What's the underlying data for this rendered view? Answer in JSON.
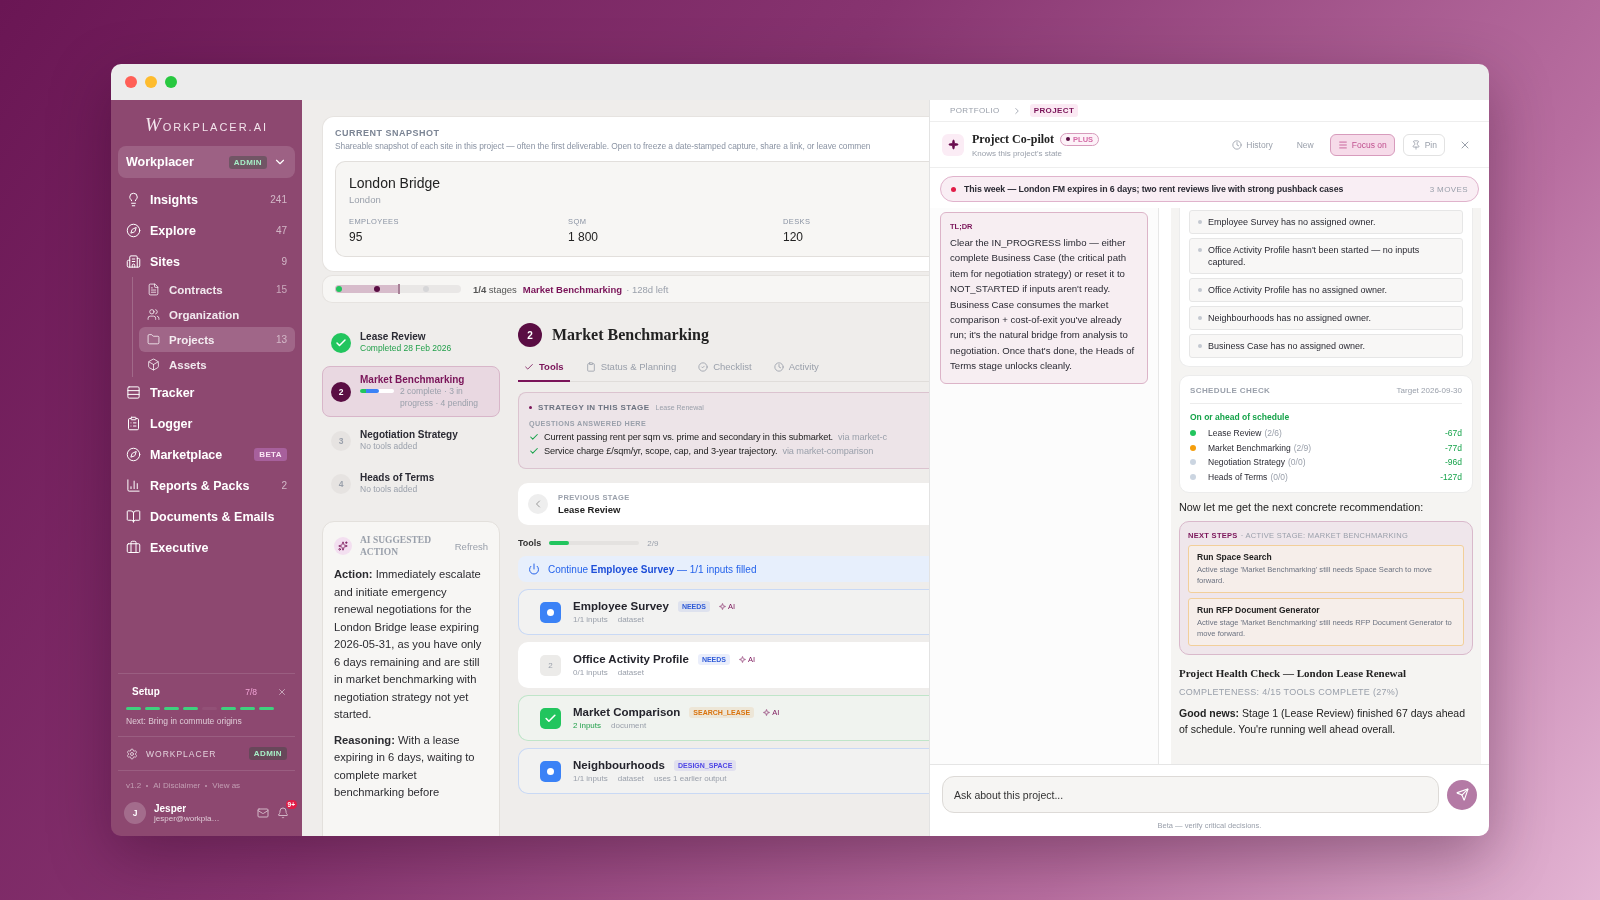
{
  "sidebar": {
    "logo": "WORKPLACER.AI",
    "workspace": {
      "name": "Workplacer",
      "badge": "ADMIN"
    },
    "nav": [
      {
        "label": "Insights",
        "count": "241",
        "selected": false
      },
      {
        "label": "Explore",
        "count": "47",
        "selected": false
      },
      {
        "label": "Sites",
        "count": "9",
        "selected": false,
        "children": [
          {
            "label": "Contracts",
            "count": "15",
            "selected": false
          },
          {
            "label": "Organization",
            "selected": false
          },
          {
            "label": "Projects",
            "count": "13",
            "selected": true
          },
          {
            "label": "Assets",
            "selected": false
          }
        ]
      },
      {
        "label": "Tracker",
        "selected": false
      },
      {
        "label": "Logger",
        "selected": false
      },
      {
        "label": "Marketplace",
        "badge": "BETA",
        "selected": false
      },
      {
        "label": "Reports & Packs",
        "count": "2",
        "selected": false
      },
      {
        "label": "Documents & Emails",
        "selected": false
      },
      {
        "label": "Executive",
        "selected": false
      }
    ],
    "setup": {
      "title": "Setup",
      "count": "7/8",
      "steps": [
        {
          "done": true
        },
        {
          "done": true
        },
        {
          "done": true
        },
        {
          "done": true
        },
        {
          "done": false
        },
        {
          "done": true
        },
        {
          "done": true
        },
        {
          "done": true
        }
      ],
      "next": "Next: Bring in commute origins"
    },
    "org": {
      "name": "WORKPLACER",
      "badge": "ADMIN"
    },
    "links": [
      "v1.2",
      "AI Disclaimer",
      "View as"
    ],
    "user": {
      "initial": "J",
      "name": "Jesper",
      "email": "jesper@workpla…",
      "notifications": "9+"
    }
  },
  "center": {
    "snapshot": {
      "title": "CURRENT SNAPSHOT",
      "description": "Shareable snapshot of each site in this project — often the first deliverable. Open to freeze a date-stamped capture, share a link, or leave commen",
      "site": {
        "name": "London Bridge",
        "city": "London",
        "stats": [
          {
            "label": "EMPLOYEES",
            "value": "95"
          },
          {
            "label": "SQM",
            "value": "1 800"
          },
          {
            "label": "DESKS",
            "value": "120"
          }
        ]
      }
    },
    "progress": {
      "summary": "**1/4** stages",
      "stage": "Market Benchmarking",
      "remaining": "· 128d left"
    },
    "stages": [
      {
        "kind": "done",
        "title": "Lease Review",
        "subtitle": "Completed 28 Feb 2026",
        "selected": false
      },
      {
        "kind": "active",
        "number": "2",
        "title": "Market Benchmarking",
        "level": 0.55,
        "subtitle": "2 complete · 3 in progress · 4 pending",
        "selected": true
      },
      {
        "kind": "pending",
        "number": "3",
        "title": "Negotiation Strategy",
        "subtitle": "No tools added",
        "selected": false
      },
      {
        "kind": "pending",
        "number": "4",
        "title": "Heads of Terms",
        "subtitle": "No tools added",
        "selected": false
      }
    ],
    "ai_action": {
      "title": "AI SUGGESTED ACTION",
      "refresh": "Refresh",
      "paragraphs": [
        "**Action:** Immediately escalate and initiate emergency renewal negotiations for the London Bridge lease expiring 2026-05-31, as you have only 6 days remaining and are still in market benchmarking with negotiation strategy not yet started.",
        "**Reasoning:** With a lease expiring in 6 days, waiting to complete market benchmarking before"
      ]
    },
    "stage_detail": {
      "number": "2",
      "title": "Market Benchmarking",
      "tabs": [
        {
          "label": "Tools",
          "selected": true
        },
        {
          "label": "Status & Planning",
          "selected": false
        },
        {
          "label": "Checklist",
          "selected": false
        },
        {
          "label": "Activity",
          "selected": false
        }
      ],
      "strategy": {
        "title": "STRATEGY IN THIS STAGE",
        "tag": "Lease Renewal",
        "questions_title": "QUESTIONS ANSWERED HERE",
        "questions": [
          {
            "text": "Current passing rent per sqm vs. prime and secondary in this submarket.",
            "source": "via market-c"
          },
          {
            "text": "Service charge £/sqm/yr, scope, cap, and 3-year trajectory.",
            "source": "via market-comparison"
          }
        ]
      },
      "previous": {
        "label": "PREVIOUS STAGE",
        "name": "Lease Review"
      },
      "tools_progress": {
        "label": "Tools",
        "level": 0.22,
        "count": "2/9"
      },
      "continue": "Continue **Employee Survey** — 1/1 inputs filled",
      "tools": [
        {
          "kind": "in_progress",
          "name": "Employee Survey",
          "tag": "NEEDS",
          "color": "#2f5bd8",
          "ai": "AI",
          "meta": [
            "1/1 inputs",
            "dataset"
          ]
        },
        {
          "kind": "pending",
          "number": "2",
          "name": "Office Activity Profile",
          "tag": "NEEDS",
          "color": "#2f5bd8",
          "ai": "AI",
          "meta": [
            "0/1 inputs",
            "dataset"
          ]
        },
        {
          "kind": "done",
          "name": "Market Comparison",
          "tag": "SEARCH_LEASE",
          "color": "#d9730d",
          "ai": "AI",
          "meta": [
            "2 inputs",
            "document"
          ]
        },
        {
          "kind": "in_progress",
          "name": "Neighbourhoods",
          "tag": "DESIGN_SPACE",
          "color": "#4f46e5",
          "meta": [
            "1/1 inputs",
            "dataset",
            "uses 1 earlier output"
          ]
        }
      ]
    }
  },
  "copilot": {
    "breadcrumb": [
      {
        "label": "PORTFOLIO",
        "selected": false
      },
      {
        "label": "PROJECT",
        "selected": true
      }
    ],
    "title": "Project Co-pilot",
    "badge": "PLUS",
    "subtitle": "Knows this project's state",
    "actions": [
      {
        "label": "History",
        "kind": "plain",
        "on": false
      },
      {
        "label": "New",
        "kind": "plain",
        "on": false
      },
      {
        "label": "Focus on",
        "kind": "outlined",
        "on": true
      },
      {
        "label": "Pin",
        "kind": "outlined",
        "on": false
      }
    ],
    "alert": {
      "text": "This week — London FM expires in 6 days; two rent reviews live with strong pushback cases",
      "count": "3 MOVES"
    },
    "tldr": {
      "label": "TL;DR",
      "text": "Clear the IN_PROGRESS limbo — either complete Business Case (the critical path item for negotiation strategy) or reset it to NOT_STARTED if inputs aren't ready. Business Case consumes the market comparison + cost-of-exit you've already run; it's the natural bridge from analysis to negotiation. Once that's done, the Heads of Terms stage unlocks cleanly."
    },
    "issues": [
      "Employee Survey has no assigned owner.",
      "Office Activity Profile hasn't been started — no inputs captured.",
      "Office Activity Profile has no assigned owner.",
      "Neighbourhoods has no assigned owner.",
      "Business Case has no assigned owner."
    ],
    "schedule": {
      "title": "SCHEDULE CHECK",
      "target": "Target 2026-09-30",
      "status": "On or ahead of schedule",
      "rows": [
        {
          "name": "Lease Review",
          "progress": "(2/6)",
          "delta": "-67d",
          "color": "#22c55e"
        },
        {
          "name": "Market Benchmarking",
          "progress": "(2/9)",
          "delta": "-77d",
          "color": "#f59e0b"
        },
        {
          "name": "Negotiation Strategy",
          "progress": "(0/0)",
          "delta": "-96d",
          "color": "#cbd5e1"
        },
        {
          "name": "Heads of Terms",
          "progress": "(0/0)",
          "delta": "-127d",
          "color": "#cbd5e1"
        }
      ]
    },
    "message": "Now let me get the next concrete recommendation:",
    "next_steps": {
      "title": "NEXT STEPS",
      "subtitle": "· ACTIVE STAGE: MARKET BENCHMARKING",
      "items": [
        {
          "title": "Run Space Search",
          "text": "Active stage 'Market Benchmarking' still needs Space Search to move forward."
        },
        {
          "title": "Run RFP Document Generator",
          "text": "Active stage 'Market Benchmarking' still needs RFP Document Generator to move forward."
        }
      ]
    },
    "health": {
      "title": "Project Health Check — London Lease Renewal",
      "completeness": "COMPLETENESS: 4/15 TOOLS COMPLETE (27%)",
      "text": "**Good news:** Stage 1 (Lease Review) finished 67 days ahead of schedule. You're running well ahead overall."
    },
    "composer": {
      "placeholder": "Ask about this project...",
      "footnote": "Beta — verify critical decisions."
    }
  }
}
